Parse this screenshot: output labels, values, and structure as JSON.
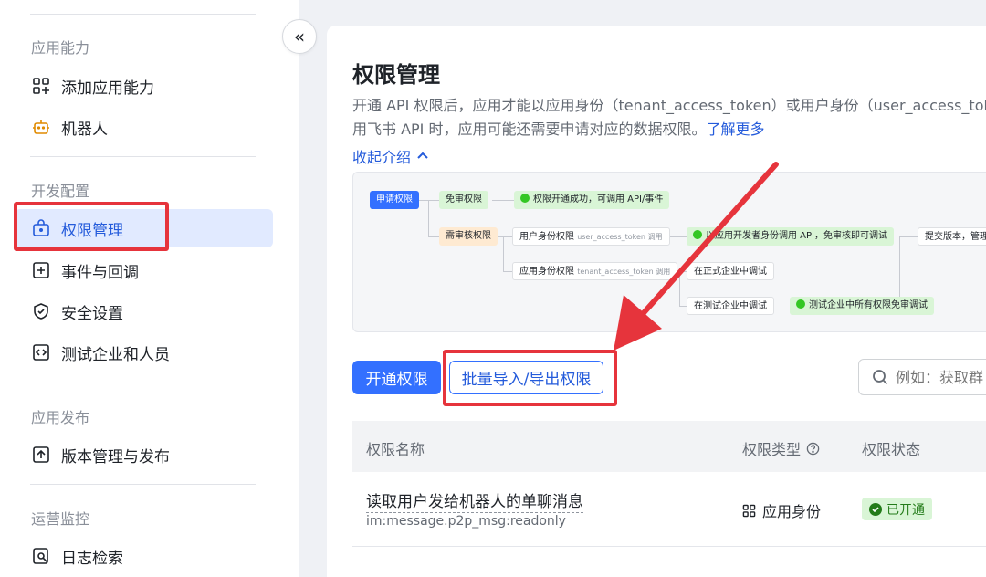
{
  "sidebar": {
    "sections": [
      {
        "title": "应用能力"
      },
      {
        "title": "开发配置"
      },
      {
        "title": "应用发布"
      },
      {
        "title": "运营监控"
      }
    ],
    "items": [
      {
        "label": "添加应用能力",
        "icon": "add-grid-icon"
      },
      {
        "label": "机器人",
        "icon": "robot-icon"
      },
      {
        "label": "权限管理",
        "icon": "lock-box-icon",
        "active": true
      },
      {
        "label": "事件与回调",
        "icon": "event-icon"
      },
      {
        "label": "安全设置",
        "icon": "shield-icon"
      },
      {
        "label": "测试企业和人员",
        "icon": "code-icon"
      },
      {
        "label": "版本管理与发布",
        "icon": "upload-icon"
      },
      {
        "label": "日志检索",
        "icon": "log-search-icon"
      }
    ],
    "collapse_glyph": "«"
  },
  "main": {
    "title": "权限管理",
    "description_line1": "开通 API 权限后，应用才能以应用身份（tenant_access_token）或用户身份（user_access_tok",
    "description_line2": "用飞书 API 时，应用可能还需要申请对应的数据权限。",
    "learn_more": "了解更多",
    "fold_label": "收起介绍",
    "diagram": {
      "apply": "申请权限",
      "no_review": "免审权限",
      "success": "权限开通成功，可调用 API/事件",
      "review": "需审核权限",
      "user_identity": "用户身份权限",
      "user_token": "user_access_token 调用",
      "dev_identity": "以应用开发者身份调用 API，免审核即可调试",
      "submit": "提交版本，管理",
      "app_identity": "应用身份权限",
      "tenant_token": "tenant_access_token 调用",
      "prod_debug": "在正式企业中调试",
      "test_debug": "在测试企业中调试",
      "test_free": "测试企业中所有权限免审调试"
    },
    "buttons": {
      "enable": "开通权限",
      "batch": "批量导入/导出权限"
    },
    "search": {
      "placeholder": "例如：获取群"
    },
    "table": {
      "headers": [
        "权限名称",
        "权限类型",
        "权限状态"
      ],
      "rows": [
        {
          "name": "读取用户发给机器人的单聊消息",
          "code": "im:message.p2p_msg:readonly",
          "type": "应用身份",
          "status": "已开通"
        }
      ]
    }
  },
  "colors": {
    "primary": "#3370ff",
    "annotation_red": "#e6343c",
    "status_green": "#34c724"
  }
}
